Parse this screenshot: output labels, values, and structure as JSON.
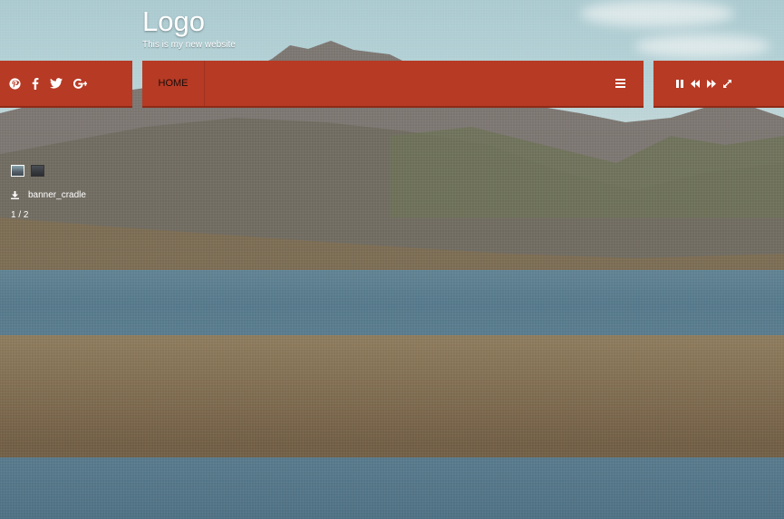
{
  "brand": {
    "logo": "Logo",
    "tagline": "This is my new website"
  },
  "social": {
    "items": [
      {
        "name": "pinterest-icon"
      },
      {
        "name": "facebook-icon"
      },
      {
        "name": "twitter-icon"
      },
      {
        "name": "google-plus-icon"
      }
    ]
  },
  "nav": {
    "home_label": "HOME",
    "menu_icon": "hamburger-menu-icon"
  },
  "player": {
    "controls": [
      "pause-icon",
      "previous-icon",
      "next-icon",
      "fullscreen-icon"
    ]
  },
  "gallery": {
    "caption": "banner_cradle",
    "counter": "1 / 2",
    "download_icon": "download-icon"
  },
  "colors": {
    "accent": "#b73a24",
    "text": "#ffffff"
  }
}
